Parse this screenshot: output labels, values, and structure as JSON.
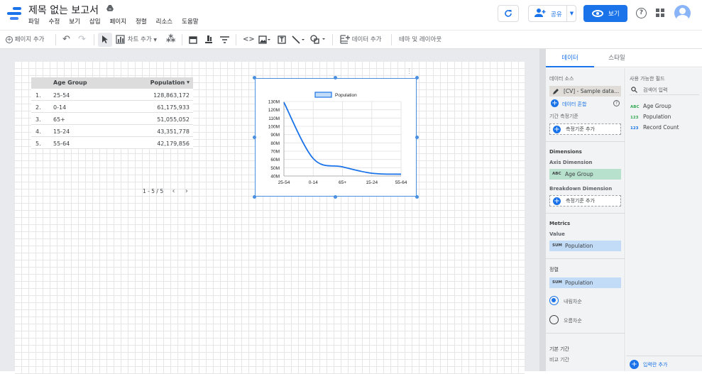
{
  "header": {
    "title": "제목 없는 보고서",
    "menu": [
      "파일",
      "수정",
      "보기",
      "삽입",
      "페이지",
      "정렬",
      "리소스",
      "도움말"
    ],
    "share_label": "공유",
    "view_label": "보기",
    "help_label": "?"
  },
  "toolbar": {
    "add_page": "페이지 추가",
    "add_chart": "차트 추가",
    "add_data": "데이터 추가",
    "theme_layout": "테마 및 레이아웃"
  },
  "table": {
    "headers": [
      "Age Group",
      "Population"
    ],
    "rows": [
      {
        "n": "1.",
        "group": "25-54",
        "pop": "128,863,172"
      },
      {
        "n": "2.",
        "group": "0-14",
        "pop": "61,175,933"
      },
      {
        "n": "3.",
        "group": "65+",
        "pop": "51,055,052"
      },
      {
        "n": "4.",
        "group": "15-24",
        "pop": "43,351,778"
      },
      {
        "n": "5.",
        "group": "55-64",
        "pop": "42,179,856"
      }
    ],
    "pager": "1 - 5 / 5"
  },
  "chart_data": {
    "type": "line",
    "categories": [
      "25-54",
      "0-14",
      "65+",
      "15-24",
      "55-64"
    ],
    "series": [
      {
        "name": "Population",
        "values": [
          128863172,
          61175933,
          51055052,
          43351778,
          42179856
        ]
      }
    ],
    "yticks": [
      "130M",
      "120M",
      "110M",
      "100M",
      "90M",
      "80M",
      "70M",
      "60M",
      "50M",
      "40M"
    ],
    "ylim": [
      40000000,
      130000000
    ],
    "legend_position": "top",
    "color": "#1a73e8"
  },
  "panel": {
    "tabs": [
      "데이터",
      "스타일"
    ],
    "data_source_label": "데이터 소스",
    "data_source_value": "[CV] - Sample data...",
    "blend_label": "데이터 혼합",
    "date_range_label": "기간 측정기준",
    "add_dimension_label": "측정기준 추가",
    "dimensions_label": "Dimensions",
    "axis_dimension_label": "Axis Dimension",
    "axis_dimension_value": "Age Group",
    "breakdown_label": "Breakdown Dimension",
    "breakdown_add": "측정기준 추가",
    "metrics_label": "Metrics",
    "value_label": "Value",
    "metric_value": "Population",
    "sort_label": "정렬",
    "sort_value": "Population",
    "sort_desc": "내림차순",
    "sort_asc": "오름차순",
    "default_range_label": "기본 기간",
    "compare_label": "비교 기간",
    "available_fields_label": "사용 가능한 필드",
    "search_placeholder": "검색어 입력",
    "fields": [
      {
        "type": "ABC",
        "name": "Age Group",
        "color": "#34a853"
      },
      {
        "type": "123",
        "name": "Population",
        "color": "#34a853"
      },
      {
        "type": "123",
        "name": "Record Count",
        "color": "#1a73e8"
      }
    ],
    "add_field_label": "입력란 추가",
    "agg_sum": "SUM",
    "type_abc": "ABC"
  }
}
